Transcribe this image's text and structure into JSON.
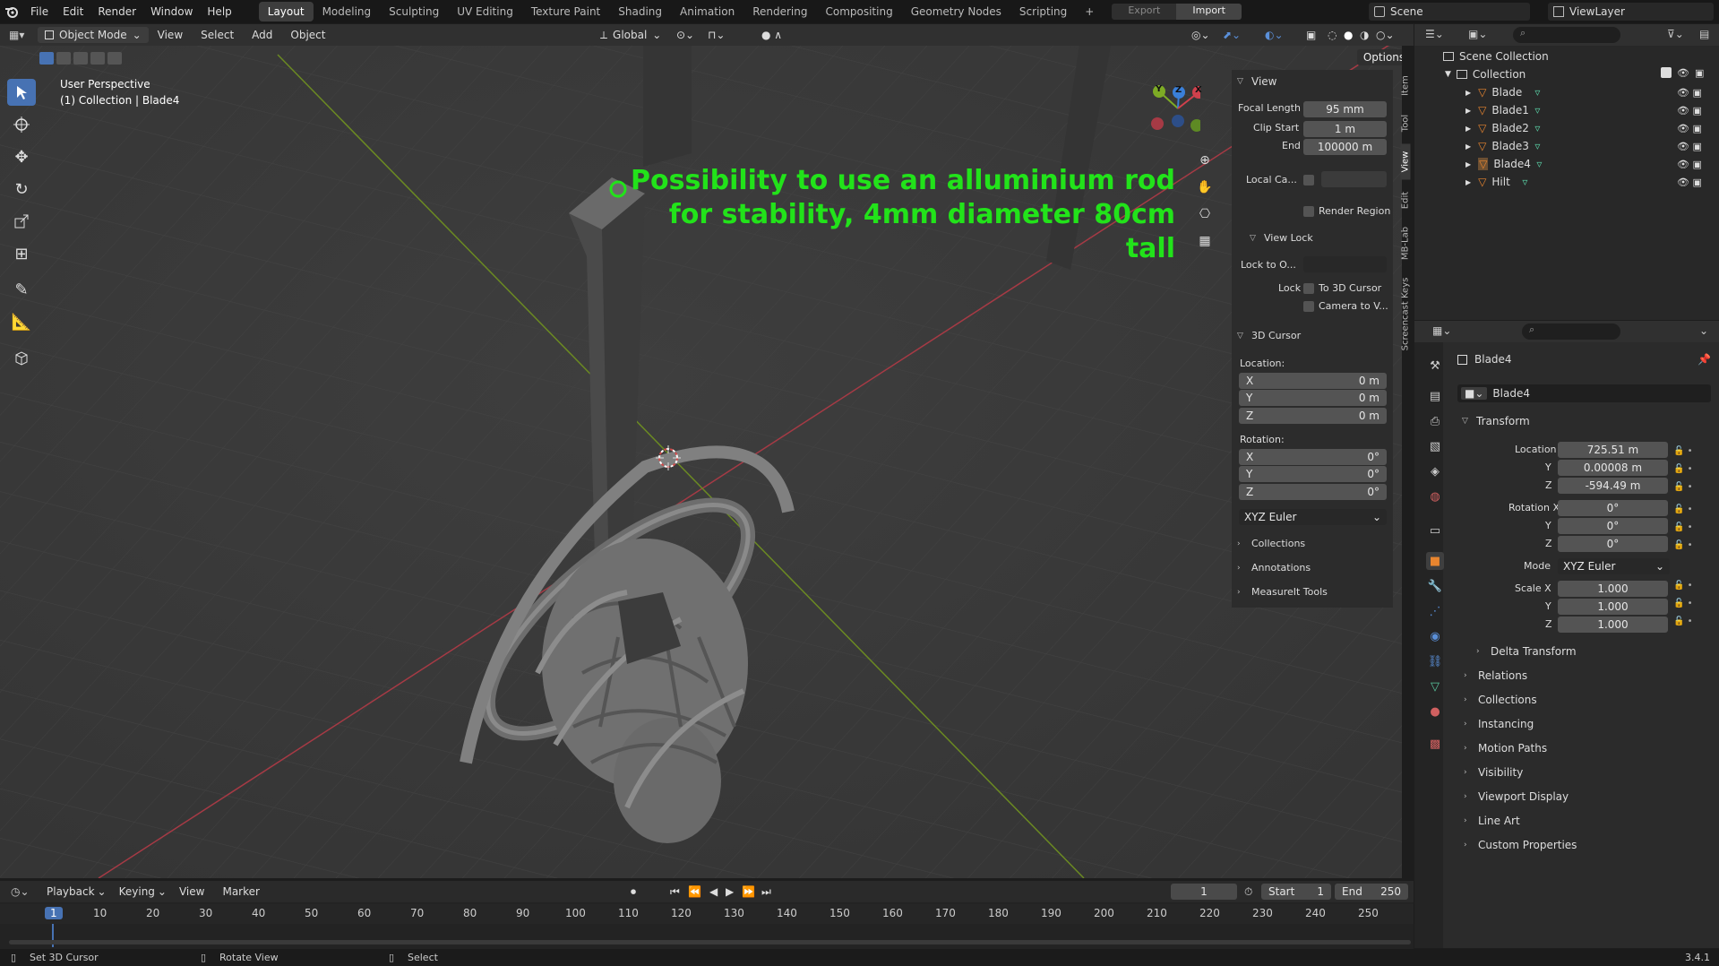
{
  "topbar": {
    "menus": [
      "File",
      "Edit",
      "Render",
      "Window",
      "Help"
    ],
    "workspaces": [
      "Layout",
      "Modeling",
      "Sculpting",
      "UV Editing",
      "Texture Paint",
      "Shading",
      "Animation",
      "Rendering",
      "Compositing",
      "Geometry Nodes",
      "Scripting"
    ],
    "add_tab": "+",
    "export_label": "Export",
    "import_label": "Import",
    "scene": "Scene",
    "view_layer": "ViewLayer"
  },
  "viewport_header": {
    "mode": "Object Mode",
    "menus": [
      "View",
      "Select",
      "Add",
      "Object"
    ],
    "orientation": "Global",
    "options": "Options"
  },
  "viewport": {
    "perspective": "User Perspective",
    "context": "(1) Collection | Blade4",
    "annotation": [
      "Possibility to use an alluminium rod",
      "for stability, 4mm diameter 80cm",
      "tall"
    ],
    "gizmo_axes": [
      "Y",
      "Z",
      "X"
    ]
  },
  "n_panel": {
    "tabs": [
      "Item",
      "Tool",
      "View",
      "Edit",
      "MB-Lab",
      "Screencast Keys"
    ],
    "view_section": "View",
    "focal_length_label": "Focal Length",
    "focal_length": "95 mm",
    "clip_start_label": "Clip Start",
    "clip_start": "1 m",
    "end_label": "End",
    "end": "100000 m",
    "local_camera_label": "Local Ca...",
    "render_region": "Render Region",
    "view_lock": "View Lock",
    "lock_to_object_label": "Lock to O...",
    "lock_label": "Lock",
    "to_3d_cursor": "To 3D Cursor",
    "camera_to_view": "Camera to V...",
    "cursor_section": "3D Cursor",
    "location_label": "Location:",
    "loc": [
      {
        "axis": "X",
        "value": "0 m"
      },
      {
        "axis": "Y",
        "value": "0 m"
      },
      {
        "axis": "Z",
        "value": "0 m"
      }
    ],
    "rotation_label": "Rotation:",
    "rot": [
      {
        "axis": "X",
        "value": "0°"
      },
      {
        "axis": "Y",
        "value": "0°"
      },
      {
        "axis": "Z",
        "value": "0°"
      }
    ],
    "rot_mode": "XYZ Euler",
    "collections": "Collections",
    "annotations": "Annotations",
    "measureit": "MeasureIt Tools"
  },
  "outliner": {
    "scene_collection": "Scene Collection",
    "collection": "Collection",
    "items": [
      "Blade",
      "Blade1",
      "Blade2",
      "Blade3",
      "Blade4",
      "Hilt"
    ],
    "selected": "Blade4"
  },
  "properties": {
    "object_name": "Blade4",
    "datablock": "Blade4",
    "transform": "Transform",
    "location": [
      {
        "label": "Location X",
        "value": "725.51 m"
      },
      {
        "label": "Y",
        "value": "0.00008 m"
      },
      {
        "label": "Z",
        "value": "-594.49 m"
      }
    ],
    "rotation": [
      {
        "label": "Rotation X",
        "value": "0°"
      },
      {
        "label": "Y",
        "value": "0°"
      },
      {
        "label": "Z",
        "value": "0°"
      }
    ],
    "mode_label": "Mode",
    "mode": "XYZ Euler",
    "scale": [
      {
        "label": "Scale X",
        "value": "1.000"
      },
      {
        "label": "Y",
        "value": "1.000"
      },
      {
        "label": "Z",
        "value": "1.000"
      }
    ],
    "delta_transform": "Delta Transform",
    "sections": [
      "Relations",
      "Collections",
      "Instancing",
      "Motion Paths",
      "Visibility",
      "Viewport Display",
      "Line Art",
      "Custom Properties"
    ]
  },
  "timeline": {
    "menus": [
      "Playback",
      "Keying",
      "View",
      "Marker"
    ],
    "current_frame": "1",
    "start_label": "Start",
    "start": "1",
    "end_label": "End",
    "end": "250",
    "ticks": [
      "1",
      "10",
      "20",
      "30",
      "40",
      "50",
      "60",
      "70",
      "80",
      "90",
      "100",
      "110",
      "120",
      "130",
      "140",
      "150",
      "160",
      "170",
      "180",
      "190",
      "200",
      "210",
      "220",
      "230",
      "240",
      "250"
    ]
  },
  "status": {
    "left": "Set 3D Cursor",
    "middle": "Rotate View",
    "right": "Select",
    "version": "3.4.1"
  },
  "colors": {
    "accent": "#4772b3",
    "annotation": "#22e31a",
    "x_axis": "#d0404c",
    "y_axis": "#7dab25",
    "z_axis": "#3a7fd8",
    "object_orange": "#e8852f",
    "mesh_green": "#58c9a0"
  }
}
